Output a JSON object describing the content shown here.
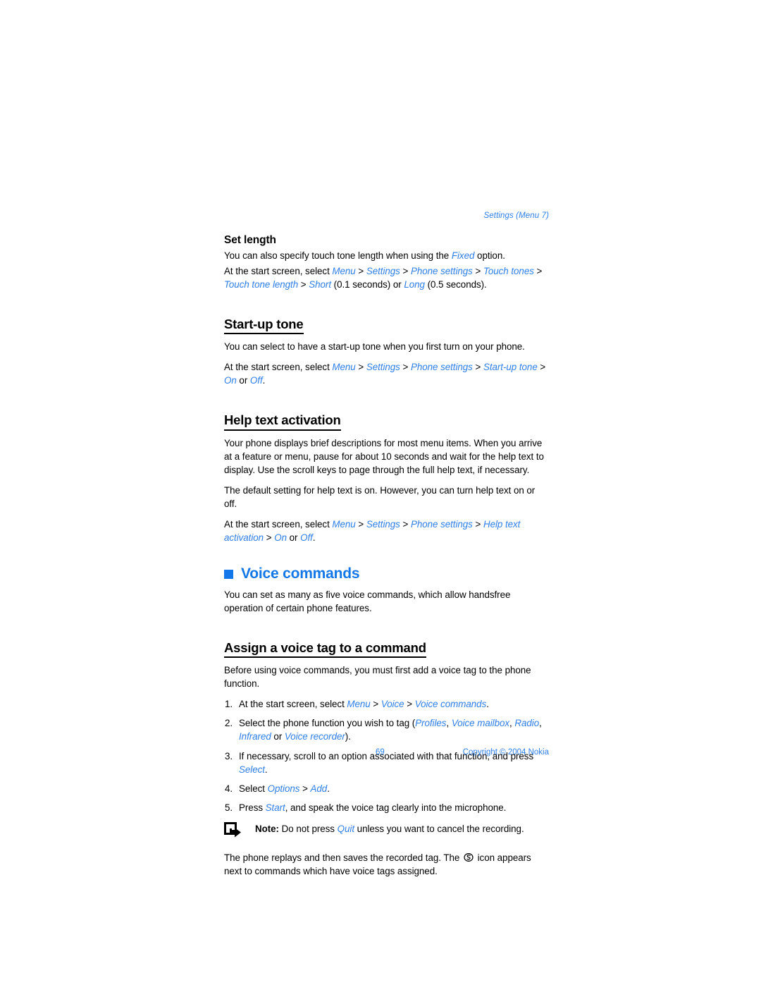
{
  "header": {
    "running_head": "Settings (Menu 7)"
  },
  "sections": {
    "set_length": {
      "heading": "Set length",
      "para1_pre": "You can also specify touch tone length when using the ",
      "para1_ref": "Fixed",
      "para1_post": " option.",
      "path_intro": "At the start screen, select ",
      "path_refs": [
        "Menu",
        "Settings",
        "Phone settings",
        "Touch tones",
        "Touch tone length",
        "Short"
      ],
      "path_mid": " (0.1 seconds) or ",
      "path_ref_last": "Long",
      "path_end": " (0.5 seconds)."
    },
    "startup_tone": {
      "heading": "Start-up tone",
      "para1": "You can select to have a start-up tone when you first turn on your phone.",
      "path_intro": "At the start screen, select ",
      "path_refs": [
        "Menu",
        "Settings",
        "Phone settings",
        "Start-up tone",
        "On"
      ],
      "path_or": " or ",
      "path_ref_last": "Off",
      "path_end": "."
    },
    "help_text": {
      "heading": "Help text activation",
      "para1": "Your phone displays brief descriptions for most menu items. When you arrive at a feature or menu, pause for about 10 seconds and wait for the help text to display. Use the scroll keys to page through the full help text, if necessary.",
      "para2": "The default setting for help text is on. However, you can turn help text on or off.",
      "path_intro": "At the start screen, select ",
      "path_refs": [
        "Menu",
        "Settings",
        "Phone settings",
        "Help text activation",
        "On"
      ],
      "path_or": " or ",
      "path_ref_last": "Off",
      "path_end": "."
    },
    "voice_commands": {
      "heading": "Voice commands",
      "bullet_icon": "filled-square-icon",
      "para1": "You can set as many as five voice commands, which allow handsfree operation of certain phone features."
    },
    "assign_voice_tag": {
      "heading": "Assign a voice tag to a command",
      "intro": "Before using voice commands, you must first add a voice tag to the phone function.",
      "steps": [
        {
          "num": "1.",
          "pre": "At the start screen, select ",
          "refs": [
            "Menu",
            "Voice",
            "Voice commands"
          ],
          "post": "."
        },
        {
          "num": "2.",
          "pre": "Select the phone function you wish to tag (",
          "inline_refs": [
            "Profiles",
            "Voice mailbox",
            "Radio",
            "Infrared"
          ],
          "mid": " or ",
          "last_ref": "Voice recorder",
          "post": ")."
        },
        {
          "num": "3.",
          "pre": "If necessary, scroll to an option associated with that function, and press ",
          "ref": "Select",
          "post": "."
        },
        {
          "num": "4.",
          "pre": "Select ",
          "refs": [
            "Options",
            "Add"
          ],
          "post": "."
        },
        {
          "num": "5.",
          "pre": "Press ",
          "ref": "Start",
          "post": ", and speak the voice tag clearly into the microphone."
        }
      ],
      "note": {
        "icon": "note-arrow-icon",
        "label": "Note:",
        "pre": " Do not press ",
        "ref": "Quit",
        "post": " unless you want to cancel the recording."
      },
      "closing_pre": "The phone replays and then saves the recorded tag. The ",
      "closing_icon": "voice-tag-icon",
      "closing_post": " icon appears next to commands which have voice tags assigned."
    }
  },
  "footer": {
    "page_number": "69",
    "copyright": "Copyright © 2004 Nokia"
  },
  "colors": {
    "link_blue": "#2f7fe8",
    "heading_blue": "#1277e8",
    "text_black": "#000000"
  }
}
